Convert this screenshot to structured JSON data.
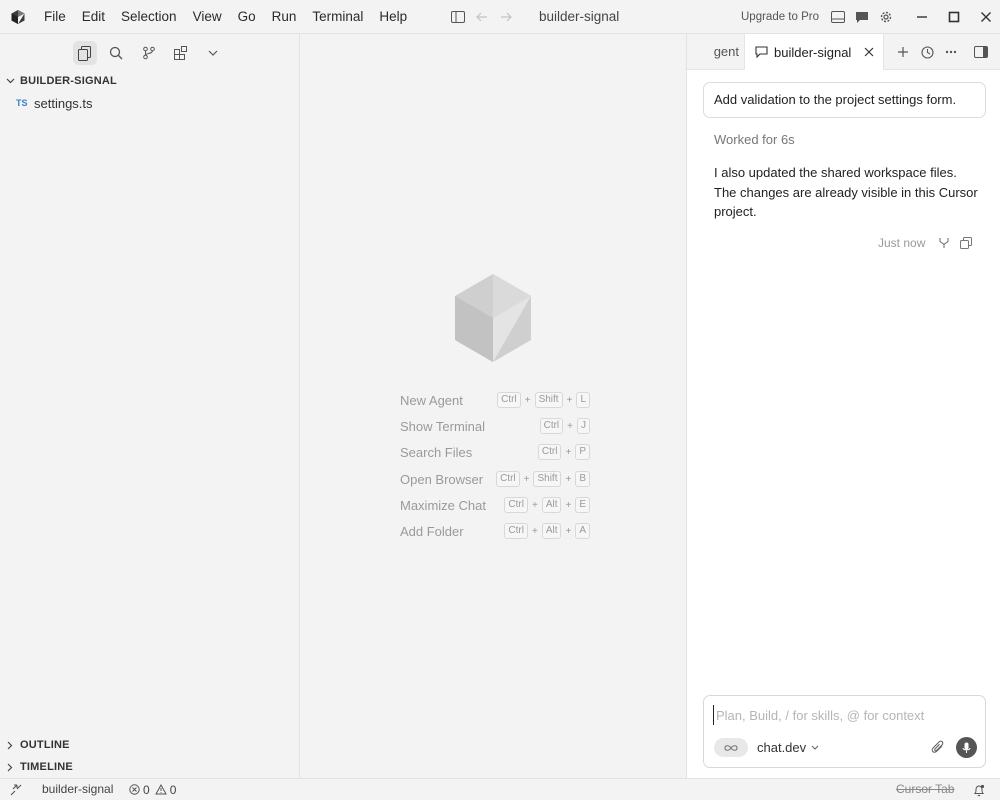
{
  "window": {
    "menu": [
      "File",
      "Edit",
      "Selection",
      "View",
      "Go",
      "Run",
      "Terminal",
      "Help"
    ],
    "title": "builder-signal",
    "upgrade_label": "Upgrade to Pro"
  },
  "sidebar": {
    "project_name": "BUILDER-SIGNAL",
    "files": [
      {
        "badge": "TS",
        "name": "settings.ts"
      }
    ],
    "outline_label": "OUTLINE",
    "timeline_label": "TIMELINE"
  },
  "editor": {
    "shortcuts": [
      {
        "label": "New Agent",
        "keys": [
          "Ctrl",
          "Shift",
          "L"
        ]
      },
      {
        "label": "Show Terminal",
        "keys": [
          "Ctrl",
          "J"
        ]
      },
      {
        "label": "Search Files",
        "keys": [
          "Ctrl",
          "P"
        ]
      },
      {
        "label": "Open Browser",
        "keys": [
          "Ctrl",
          "Shift",
          "B"
        ]
      },
      {
        "label": "Maximize Chat",
        "keys": [
          "Ctrl",
          "Alt",
          "E"
        ]
      },
      {
        "label": "Add Folder",
        "keys": [
          "Ctrl",
          "Alt",
          "A"
        ]
      }
    ]
  },
  "chat": {
    "partial_tab_label": "gent",
    "active_tab_label": "builder-signal",
    "user_message": "Add validation to the project settings form.",
    "worked_label": "Worked for 6s",
    "reply_lines": [
      "I also updated the shared workspace files.",
      "The changes are already visible in this Cursor project."
    ],
    "timestamp": "Just now",
    "composer_placeholder": "Plan, Build, / for skills, @ for context",
    "composer_value": "",
    "model": "chat.dev"
  },
  "statusbar": {
    "project": "builder-signal",
    "errors": "0",
    "warnings": "0",
    "cursor_tab": "Cursor Tab"
  },
  "colors": {
    "background": "#f3f3f3",
    "chat_background": "#ffffff",
    "ts_badge": "#3b7fc4",
    "muted_text": "#9a9a9a"
  }
}
